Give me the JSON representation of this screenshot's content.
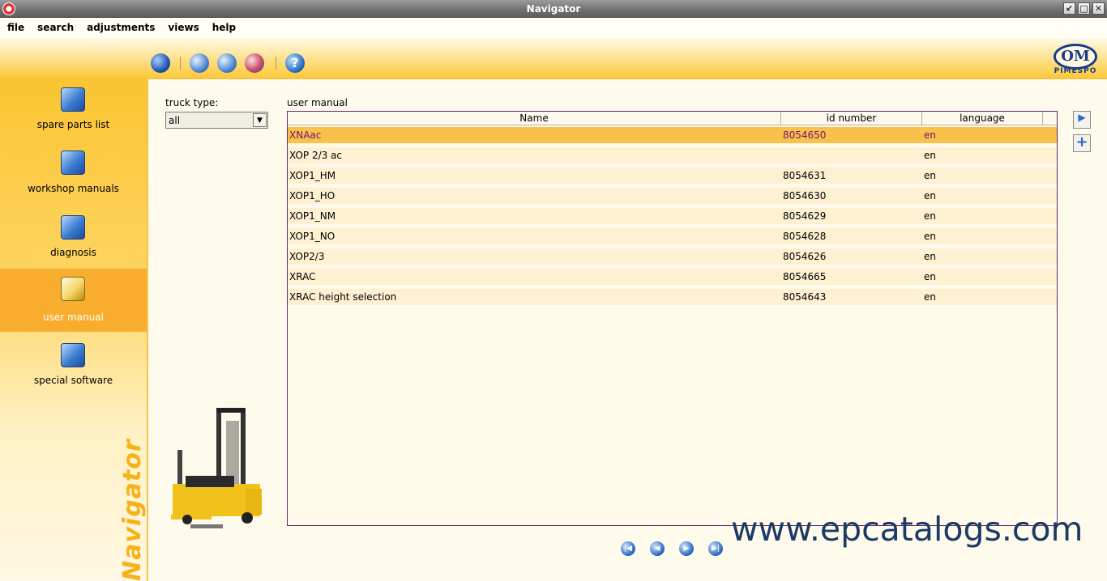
{
  "window": {
    "title": "Navigator"
  },
  "menu": [
    "file",
    "search",
    "adjustments",
    "views",
    "help"
  ],
  "toolbar": {
    "icons": [
      "globe-icon",
      "search-icon",
      "search-advanced-icon",
      "print-icon",
      "help-icon"
    ],
    "help_glyph": "?"
  },
  "logo": {
    "main": "OM",
    "sub": "PIMESPO"
  },
  "sidebar": {
    "items": [
      {
        "label": "spare parts list",
        "icon": "folder-icon"
      },
      {
        "label": "workshop manuals",
        "icon": "folder-icon"
      },
      {
        "label": "diagnosis",
        "icon": "folder-icon"
      },
      {
        "label": "user manual",
        "icon": "folder-icon",
        "active": true
      },
      {
        "label": "special software",
        "icon": "folder-icon"
      }
    ],
    "brand": "Navigator"
  },
  "filter": {
    "label": "truck type:",
    "value": "all"
  },
  "panel": {
    "title": "user manual",
    "columns": [
      "Name",
      "id number",
      "language"
    ],
    "rows": [
      {
        "name": "XNAac",
        "id": "8054650",
        "lang": "en",
        "selected": true
      },
      {
        "name": "XOP 2/3 ac",
        "id": "",
        "lang": "en"
      },
      {
        "name": "XOP1_HM",
        "id": "8054631",
        "lang": "en"
      },
      {
        "name": "XOP1_HO",
        "id": "8054630",
        "lang": "en"
      },
      {
        "name": "XOP1_NM",
        "id": "8054629",
        "lang": "en"
      },
      {
        "name": "XOP1_NO",
        "id": "8054628",
        "lang": "en"
      },
      {
        "name": "XOP2/3",
        "id": "8054626",
        "lang": "en"
      },
      {
        "name": "XRAC",
        "id": "8054665",
        "lang": "en"
      },
      {
        "name": "XRAC height selection",
        "id": "8054643",
        "lang": "en"
      }
    ]
  },
  "actions": {
    "open_glyph": "▶",
    "add_glyph": "+"
  },
  "pager": {
    "first": "|◀",
    "prev": "◀",
    "next": "▶",
    "last": "▶|"
  },
  "watermark": "www.epcatalogs.com",
  "colors": {
    "accent": "#f9ad2e",
    "selected_row": "#f9c04a",
    "selected_text": "#6a1a7a"
  }
}
